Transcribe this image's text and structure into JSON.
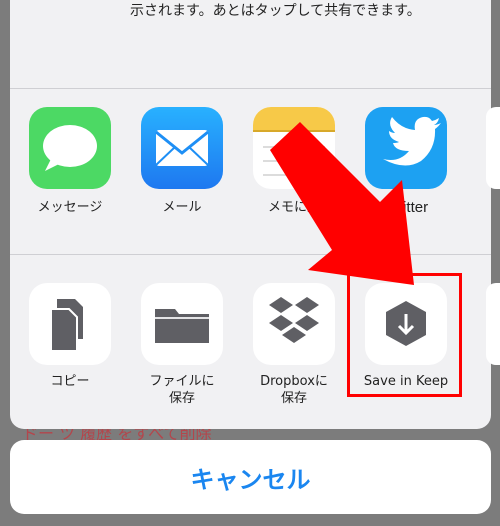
{
  "background": {
    "text": "ドー ツ 履歴 をすべて削除"
  },
  "airdrop": {
    "description": "示されます。あとはタップして共有できます。",
    "icon": "airdrop-icon"
  },
  "apps": [
    {
      "label": "メッセージ",
      "icon": "messages-icon",
      "color": "#4cd964"
    },
    {
      "label": "メール",
      "icon": "mail-icon",
      "color": "#1e8ff5"
    },
    {
      "label": "メモに追",
      "icon": "notes-icon",
      "color": "#ffffff"
    },
    {
      "label": "Twitter",
      "icon": "twitter-icon",
      "color": "#1da1f2"
    }
  ],
  "actions": [
    {
      "label": "コピー",
      "icon": "copy-icon"
    },
    {
      "label": "ファイルに\n保存",
      "icon": "folder-icon"
    },
    {
      "label": "Dropboxに\n保存",
      "icon": "dropbox-icon"
    },
    {
      "label": "Save in Keep",
      "icon": "keep-icon"
    }
  ],
  "cancel_label": "キャンセル",
  "colors": {
    "highlight": "#ff0000",
    "cancel_text": "#1a86f0"
  }
}
